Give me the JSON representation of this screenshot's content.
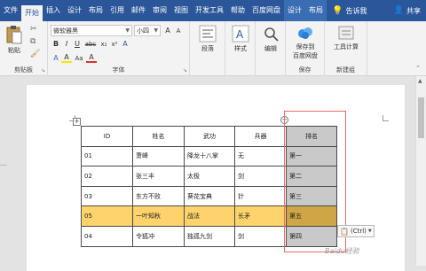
{
  "tabs": {
    "file": "文件",
    "home": "开始",
    "insert": "插入",
    "design": "设计",
    "layout": "布局",
    "references": "引用",
    "mailings": "邮件",
    "review": "审阅",
    "view": "视图",
    "developer": "开发工具",
    "help": "帮助",
    "baidu": "百度网盘",
    "table_design": "设计",
    "table_layout": "布局"
  },
  "tell_me": "告诉我",
  "share": "共享",
  "ribbon": {
    "clipboard": {
      "paste": "粘贴",
      "label": "剪贴板"
    },
    "font": {
      "family": "微软雅黑",
      "size": "小四",
      "label": "字体",
      "row2": [
        "B",
        "I",
        "U",
        "abc",
        "x₂",
        "x²",
        "A"
      ],
      "row3": [
        "A",
        "A",
        "Aa",
        "A"
      ]
    },
    "paragraph": {
      "label": "段落"
    },
    "styles": {
      "label": "样式"
    },
    "editing": {
      "label": "编辑"
    },
    "save": {
      "line1": "保存到",
      "line2": "百度网盘",
      "label": "保存"
    },
    "newgroup": {
      "tools": "工具计算",
      "label": "新建组"
    }
  },
  "table": {
    "headers": [
      "ID",
      "姓名",
      "武功",
      "兵器",
      "排名"
    ],
    "rows": [
      [
        "01",
        "萧峰",
        "降龙十八掌",
        "无",
        "第一"
      ],
      [
        "02",
        "张三丰",
        "太极",
        "剑",
        "第二"
      ],
      [
        "03",
        "东方不败",
        "葵花宝典",
        "针",
        "第三"
      ],
      [
        "05",
        "一叶知秋",
        "战法",
        "长矛",
        "第五"
      ],
      [
        "04",
        "令狐冲",
        "独孤九剑",
        "剑",
        "第四"
      ]
    ]
  },
  "paste_options": "(Ctrl)",
  "watermark": "Baidu经验",
  "colors": {
    "title_bar": "#2b579a",
    "highlight_row": "#ffd36b",
    "selected_col": "#c9c9c9"
  }
}
